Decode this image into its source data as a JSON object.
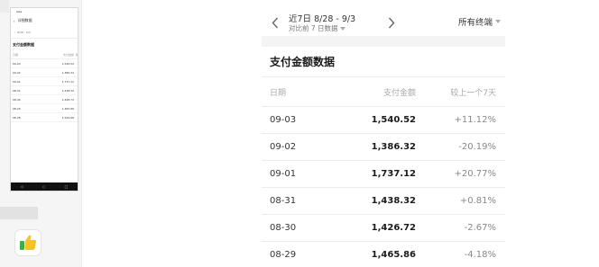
{
  "phone": {
    "title": "详细数据",
    "date_range": "8/28 - 9/3",
    "section": "支付金额数据",
    "columns": [
      "日期",
      "支付金额",
      "较上"
    ],
    "rows": [
      {
        "date": "09-03",
        "amount": "1,540.52",
        "change": "+"
      },
      {
        "date": "09-02",
        "amount": "1,386.32",
        "change": "-"
      },
      {
        "date": "09-01",
        "amount": "1,737.12",
        "change": "+"
      },
      {
        "date": "08-31",
        "amount": "1,438.32",
        "change": "+"
      },
      {
        "date": "08-30",
        "amount": "1,426.72",
        "change": "-"
      },
      {
        "date": "08-29",
        "amount": "1,465.86",
        "change": "-"
      },
      {
        "date": "08-28",
        "amount": "1,529.98",
        "change": "+"
      }
    ]
  },
  "header": {
    "range_label": "近7日 8/28 - 9/3",
    "compare_label": "对比前 7 日数据",
    "terminal_label": "所有终端"
  },
  "section_title": "支付金额数据",
  "table": {
    "columns": {
      "date": "日期",
      "amount": "支付金额",
      "change": "较上一个7天"
    },
    "rows": [
      {
        "date": "09-03",
        "amount": "1,540.52",
        "change": "+11.12%"
      },
      {
        "date": "09-02",
        "amount": "1,386.32",
        "change": "-20.19%"
      },
      {
        "date": "09-01",
        "amount": "1,737.12",
        "change": "+20.77%"
      },
      {
        "date": "08-31",
        "amount": "1,438.32",
        "change": "+0.81%"
      },
      {
        "date": "08-30",
        "amount": "1,426.72",
        "change": "-2.67%"
      },
      {
        "date": "08-29",
        "amount": "1,465.86",
        "change": "-4.18%"
      }
    ]
  },
  "icons": {
    "prev": "chevron-left-icon",
    "next": "chevron-right-icon",
    "dropdown": "caret-down-icon",
    "thumbs": "thumbs-up-icon"
  },
  "colors": {
    "accent_green": "#3fae49",
    "accent_yellow": "#f6c12b",
    "text_muted": "#888888"
  }
}
